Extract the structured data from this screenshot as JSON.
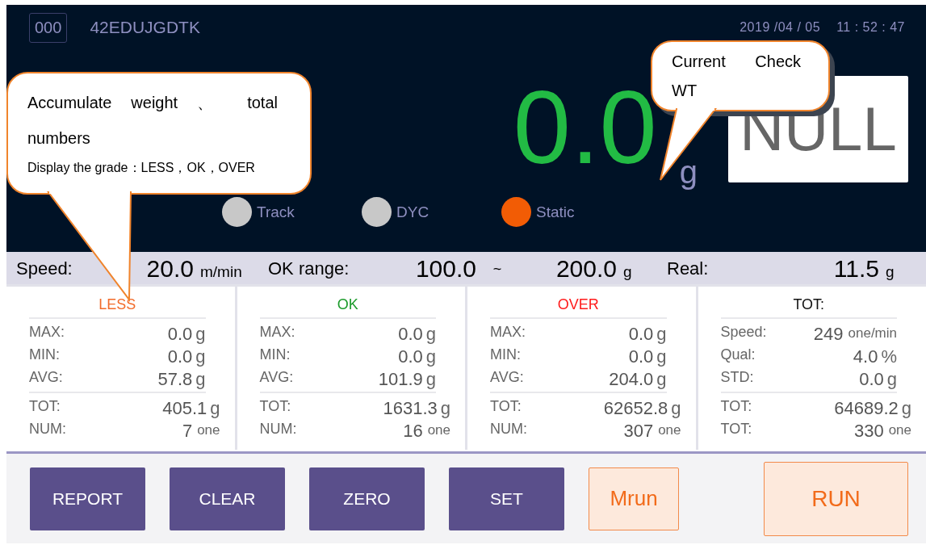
{
  "header": {
    "code": "000",
    "id": "42EDUJGDTK",
    "date": "2019 /04 / 05",
    "time": "11 : 52 : 47"
  },
  "display": {
    "weight": "0.0",
    "unit": "g",
    "grade": "NULL"
  },
  "indicators": [
    {
      "label": "Track",
      "on": false
    },
    {
      "label": "DYC",
      "on": false
    },
    {
      "label": "Static",
      "on": true
    }
  ],
  "settings": {
    "speed": {
      "label": "Speed:",
      "value": "20.0",
      "unit": "m/min"
    },
    "ok_range": {
      "label": "OK range:",
      "low": "100.0",
      "separator": "~",
      "high": "200.0",
      "unit": "g"
    },
    "real": {
      "label": "Real:",
      "value": "11.5",
      "unit": "g"
    }
  },
  "cards": [
    {
      "title": "LESS",
      "color": "#f26b2a",
      "rows": [
        {
          "label": "MAX:",
          "value": "0.0",
          "unit": "g"
        },
        {
          "label": "MIN:",
          "value": "0.0",
          "unit": "g"
        },
        {
          "label": "AVG:",
          "value": "57.8",
          "unit": "g"
        }
      ],
      "totals": [
        {
          "label": "TOT:",
          "value": "405.1",
          "unit": "g"
        },
        {
          "label": "NUM:",
          "value": "7",
          "unit": "one"
        }
      ]
    },
    {
      "title": "OK",
      "color": "#1a9a2a",
      "rows": [
        {
          "label": "MAX:",
          "value": "0.0",
          "unit": "g"
        },
        {
          "label": "MIN:",
          "value": "0.0",
          "unit": "g"
        },
        {
          "label": "AVG:",
          "value": "101.9",
          "unit": "g"
        }
      ],
      "totals": [
        {
          "label": "TOT:",
          "value": "1631.3",
          "unit": "g"
        },
        {
          "label": "NUM:",
          "value": "16",
          "unit": "one"
        }
      ]
    },
    {
      "title": "OVER",
      "color": "#ff1a1a",
      "rows": [
        {
          "label": "MAX:",
          "value": "0.0",
          "unit": "g"
        },
        {
          "label": "MIN:",
          "value": "0.0",
          "unit": "g"
        },
        {
          "label": "AVG:",
          "value": "204.0",
          "unit": "g"
        }
      ],
      "totals": [
        {
          "label": "TOT:",
          "value": "62652.8",
          "unit": "g"
        },
        {
          "label": "NUM:",
          "value": "307",
          "unit": "one"
        }
      ]
    },
    {
      "title": "TOT:",
      "color": "#111111",
      "rows": [
        {
          "label": "Speed:",
          "value": "249",
          "unit": "one/min"
        },
        {
          "label": "Qual:",
          "value": "4.0",
          "unit": "%"
        },
        {
          "label": "STD:",
          "value": "0.0",
          "unit": "g"
        }
      ],
      "totals": [
        {
          "label": "TOT:",
          "value": "64689.2",
          "unit": "g"
        },
        {
          "label": "TOT:",
          "value": "330",
          "unit": "one"
        }
      ]
    }
  ],
  "buttons": [
    {
      "label": "REPORT",
      "kind": "primary"
    },
    {
      "label": "CLEAR",
      "kind": "primary"
    },
    {
      "label": "ZERO",
      "kind": "primary"
    },
    {
      "label": "SET",
      "kind": "primary"
    },
    {
      "label": "Mrun",
      "kind": "accent"
    },
    {
      "label": "RUN",
      "kind": "run"
    }
  ],
  "callouts": [
    {
      "kind": "left",
      "lines": [
        "Accumulate weight 、 total numbers",
        "Display the grade：LESS，OK，OVER"
      ]
    },
    {
      "kind": "right",
      "lines": [
        "Current Check WT"
      ]
    }
  ]
}
